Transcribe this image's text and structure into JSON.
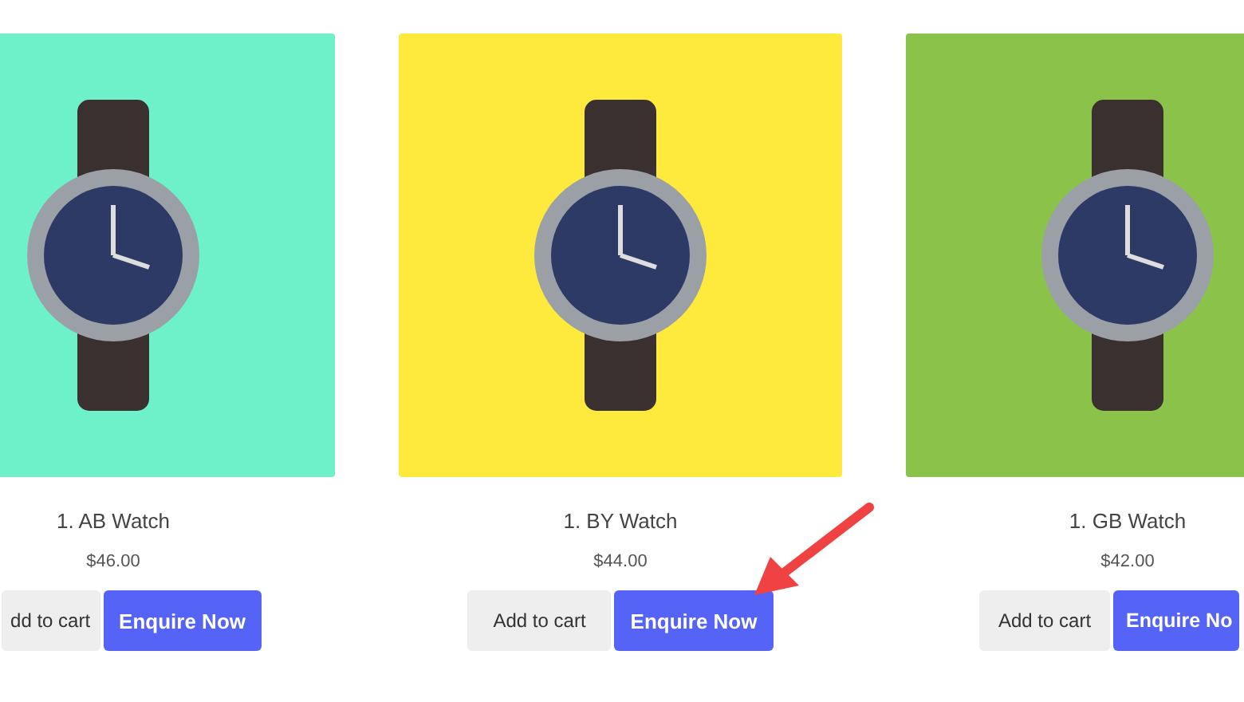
{
  "products": [
    {
      "kind": "left-edge",
      "color": "#6ef0c9",
      "title": "1. AB Watch",
      "price": "$46.00",
      "cart_button": "dd to cart",
      "enquire_button": "Enquire Now"
    },
    {
      "kind": "full",
      "color": "#fdea3c",
      "title": "1. BY Watch",
      "price": "$44.00",
      "cart_button": "Add to cart",
      "enquire_button": "Enquire Now",
      "pointer_arrow": true
    },
    {
      "kind": "right-edge",
      "color": "#8bc34a",
      "title": "1. GB Watch",
      "price": "$42.00",
      "cart_button": "Add to cart",
      "enquire_button": "Enquire No"
    }
  ]
}
